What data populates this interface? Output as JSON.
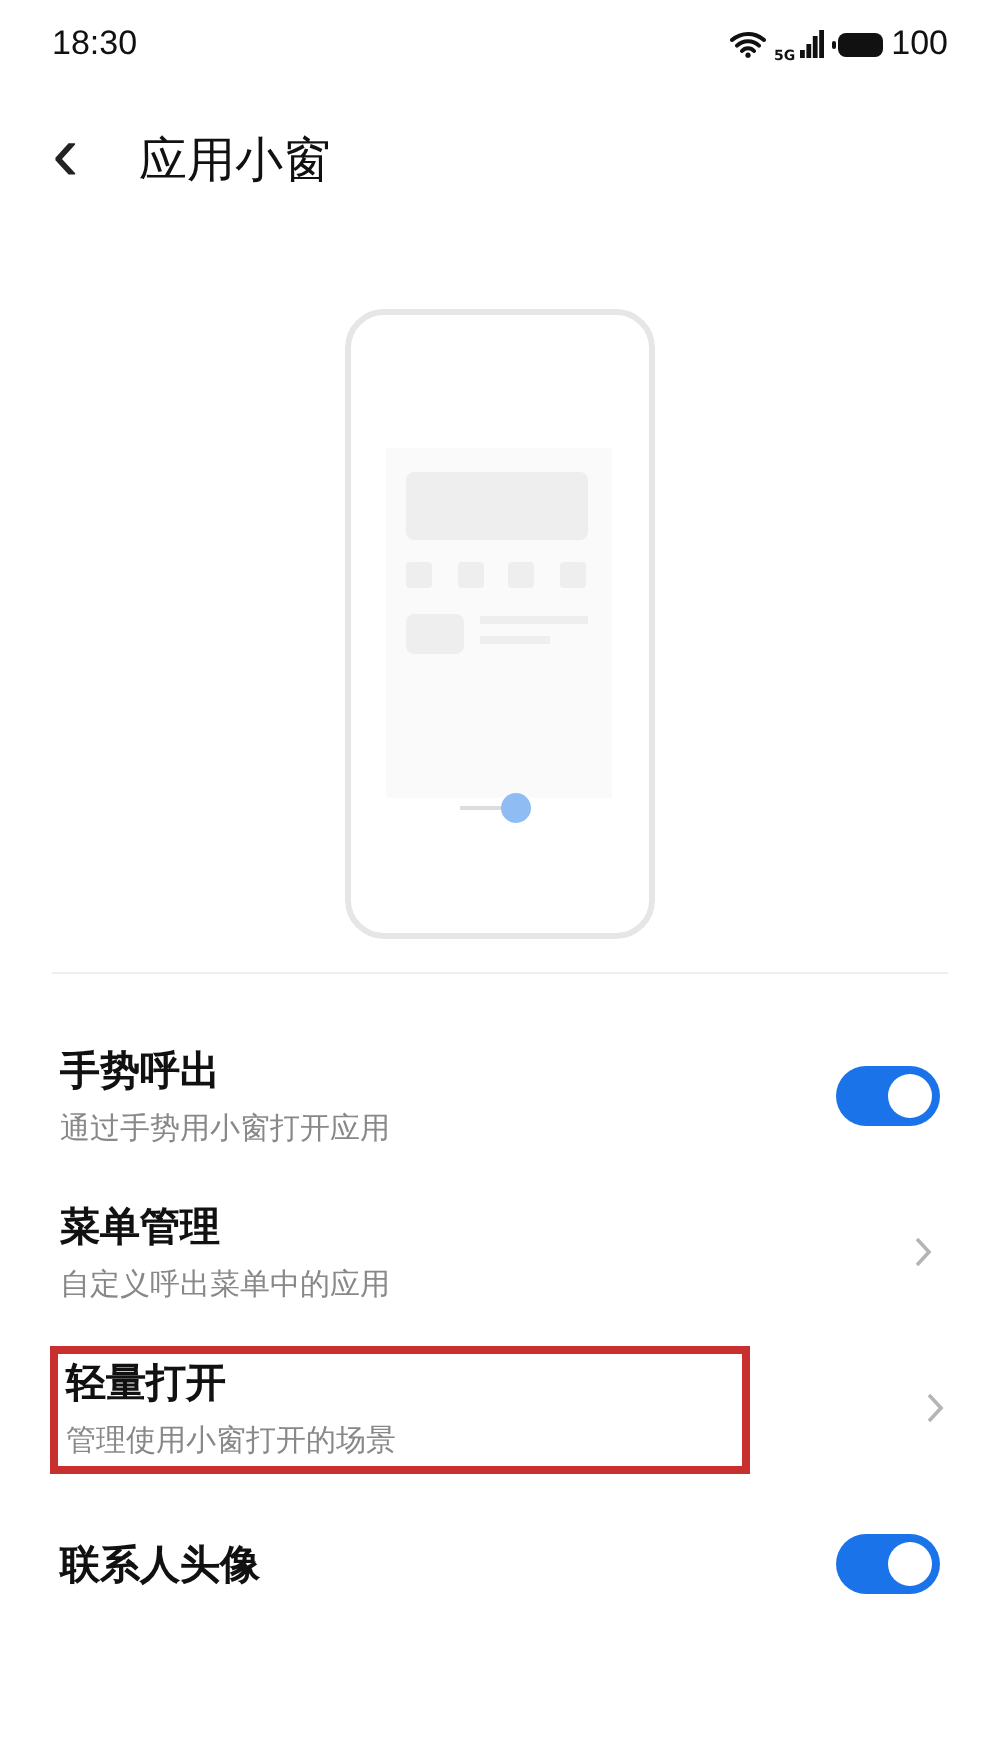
{
  "status_bar": {
    "time": "18:30",
    "network": "5G",
    "battery": "100"
  },
  "header": {
    "back": "‹",
    "title": "应用小窗"
  },
  "settings": [
    {
      "kind": "toggle",
      "title": "手势呼出",
      "subtitle": "通过手势用小窗打开应用",
      "on": true,
      "highlighted": false
    },
    {
      "kind": "link",
      "title": "菜单管理",
      "subtitle": "自定义呼出菜单中的应用",
      "highlighted": false
    },
    {
      "kind": "link",
      "title": "轻量打开",
      "subtitle": "管理使用小窗打开的场景",
      "highlighted": true
    },
    {
      "kind": "toggle",
      "title": "联系人头像",
      "on": true,
      "highlighted": false
    }
  ]
}
